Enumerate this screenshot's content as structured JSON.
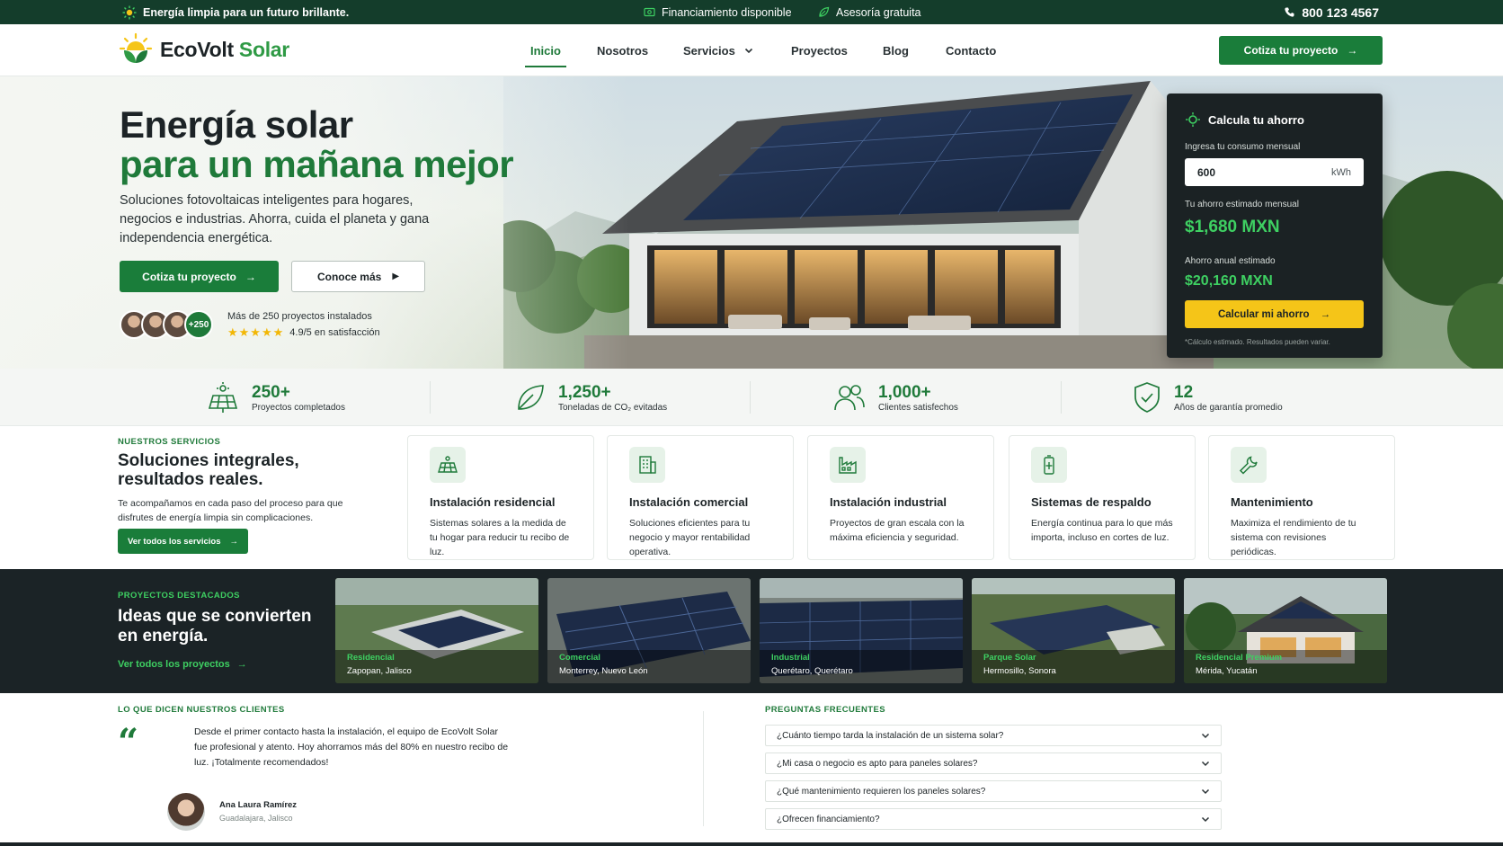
{
  "topbar": {
    "tagline": "Energía limpia para un futuro brillante.",
    "financing": "Financiamiento disponible",
    "advice": "Asesoría gratuita",
    "phone": "800 123 4567"
  },
  "brand": {
    "name_part1": "EcoVolt",
    "name_part2": "Solar"
  },
  "nav": {
    "items": [
      "Inicio",
      "Nosotros",
      "Servicios",
      "Proyectos",
      "Blog",
      "Contacto"
    ],
    "active": "Inicio",
    "cta": "Cotiza tu proyecto"
  },
  "hero": {
    "title_line1": "Energía solar",
    "title_line2": "para un mañana mejor",
    "subtitle": "Soluciones fotovoltaicas inteligentes para hogares, negocios e industrias. Ahorra, cuida el planeta y gana independencia energética.",
    "primary_cta": "Cotiza tu proyecto",
    "secondary_cta": "Conoce más",
    "avatar_count": "+250",
    "projects_text": "Más de 250 proyectos instalados",
    "rating": 4.9,
    "rating_text": "4.9/5 en satisfacción"
  },
  "calculator": {
    "title": "Calcula tu ahorro",
    "input_label": "Ingresa tu consumo mensual",
    "input_value": "600",
    "input_unit": "kWh",
    "monthly_label": "Tu ahorro estimado mensual",
    "monthly_value": "$1,680 MXN",
    "annual_label": "Ahorro anual estimado",
    "annual_value": "$20,160 MXN",
    "button": "Calcular mi ahorro",
    "note": "*Cálculo estimado. Resultados pueden variar."
  },
  "stats": [
    {
      "value": "250+",
      "label": "Proyectos completados",
      "icon": "solar-panel-icon"
    },
    {
      "value": "1,250+",
      "label": "Toneladas de CO₂ evitadas",
      "icon": "leaf-icon"
    },
    {
      "value": "1,000+",
      "label": "Clientes satisfechos",
      "icon": "users-icon"
    },
    {
      "value": "12",
      "label": "Años de garantía promedio",
      "icon": "shield-check-icon"
    }
  ],
  "services": {
    "eyebrow": "NUESTROS SERVICIOS",
    "heading": "Soluciones integrales, resultados reales.",
    "description": "Te acompañamos en cada paso del proceso para que disfrutes de energía limpia sin complicaciones.",
    "button": "Ver todos los servicios",
    "items": [
      {
        "title": "Instalación residencial",
        "text": "Sistemas solares a la medida de tu hogar para reducir tu recibo de luz.",
        "icon": "solar-panel-icon"
      },
      {
        "title": "Instalación comercial",
        "text": "Soluciones eficientes para tu negocio y mayor rentabilidad operativa.",
        "icon": "building-icon"
      },
      {
        "title": "Instalación industrial",
        "text": "Proyectos de gran escala con la máxima eficiencia y seguridad.",
        "icon": "factory-icon"
      },
      {
        "title": "Sistemas de respaldo",
        "text": "Energía continua para lo que más importa, incluso en cortes de luz.",
        "icon": "battery-icon"
      },
      {
        "title": "Mantenimiento",
        "text": "Maximiza el rendimiento de tu sistema con revisiones periódicas.",
        "icon": "wrench-icon"
      }
    ]
  },
  "projects": {
    "eyebrow": "PROYECTOS DESTACADOS",
    "heading": "Ideas que se convierten en energía.",
    "link": "Ver todos los proyectos",
    "items": [
      {
        "category": "Residencial",
        "location": "Zapopan, Jalisco"
      },
      {
        "category": "Comercial",
        "location": "Monterrey, Nuevo León"
      },
      {
        "category": "Industrial",
        "location": "Querétaro, Querétaro"
      },
      {
        "category": "Parque Solar",
        "location": "Hermosillo, Sonora"
      },
      {
        "category": "Residencial Premium",
        "location": "Mérida, Yucatán"
      }
    ]
  },
  "testimonials": {
    "eyebrow": "LO QUE DICEN NUESTROS CLIENTES",
    "quote": "Desde el primer contacto hasta la instalación, el equipo de EcoVolt Solar fue profesional y atento. Hoy ahorramos más del 80% en nuestro recibo de luz. ¡Totalmente recomendados!",
    "name": "Ana Laura Ramírez",
    "city": "Guadalajara, Jalisco",
    "slide_count": 3,
    "active_slide": 1
  },
  "faq": {
    "eyebrow": "PREGUNTAS FRECUENTES",
    "items": [
      "¿Cuánto tiempo tarda la instalación de un sistema solar?",
      "¿Mi casa o negocio es apto para paneles solares?",
      "¿Qué mantenimiento requieren los paneles solares?",
      "¿Ofrecen financiamiento?"
    ]
  },
  "colors": {
    "brand_green": "#1f7a3a",
    "accent_green": "#3ed062",
    "dark": "#1b2326",
    "topbar": "#143d2b",
    "cta_yellow": "#f5c518"
  }
}
